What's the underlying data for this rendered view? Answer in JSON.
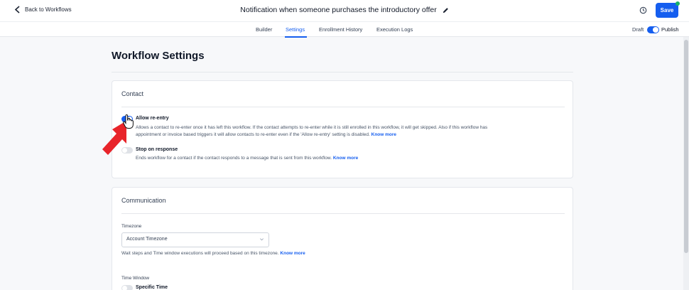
{
  "header": {
    "back_label": "Back to Workflows",
    "workflow_title": "Notification when someone purchases the introductory offer",
    "save_label": "Save"
  },
  "tabs": [
    {
      "label": "Builder",
      "active": false
    },
    {
      "label": "Settings",
      "active": true
    },
    {
      "label": "Enrollment History",
      "active": false
    },
    {
      "label": "Execution Logs",
      "active": false
    }
  ],
  "publish": {
    "draft_label": "Draft",
    "publish_label": "Publish",
    "state": "on"
  },
  "page": {
    "title": "Workflow Settings"
  },
  "contact": {
    "heading": "Contact",
    "allow_reentry": {
      "label": "Allow re-entry",
      "state": "on",
      "desc_line1": "Allows a contact to re-enter once it has left this workflow. If the contact attempts to re-enter while it is still enrolled in this workflow, it will get skipped. Also if this workflow has",
      "desc_line2": "appointment or invoice based triggers it will allow contacts to re-enter even if the 'Allow re-entry' setting is disabled.",
      "link": "Know more"
    },
    "stop_on_response": {
      "label": "Stop on response",
      "state": "off",
      "desc": "Ends workflow for a contact if the contact responds to a message that is sent from this workflow.",
      "link": "Know more"
    }
  },
  "communication": {
    "heading": "Communication",
    "timezone_label": "Timezone",
    "timezone_value": "Account Timezone",
    "timezone_help": "Wait steps and Time window executions will proceed based on this timezone.",
    "timezone_link": "Know more",
    "time_window_label": "Time Window",
    "specific_time_label": "Specific Time",
    "specific_time_state": "off"
  },
  "colors": {
    "accent": "#155eef",
    "annotation_arrow": "#e8242a",
    "online_dot": "#17b26a"
  }
}
